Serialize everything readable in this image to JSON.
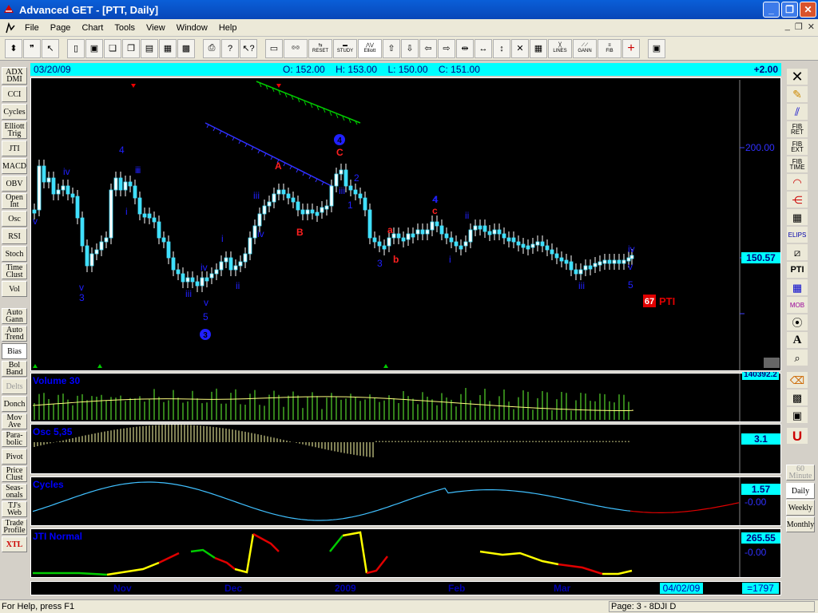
{
  "window": {
    "title": "Advanced GET - [PTT, Daily]"
  },
  "menu": [
    "File",
    "Page",
    "Chart",
    "Tools",
    "View",
    "Window",
    "Help"
  ],
  "toolbar": {
    "reset": "RESET",
    "study": "STUDY",
    "elliott": "Elliott",
    "lines": "LINES",
    "gann": "GANN",
    "fib": "FIB"
  },
  "left_tools": [
    "ADX DMI",
    "CCI",
    "Cycles",
    "Elliott Trig",
    "JTI",
    "MACD",
    "OBV",
    "Open Int",
    "Osc",
    "RSI",
    "Stoch",
    "Time Clust",
    "Vol",
    "Auto Gann",
    "Auto Trend",
    "Bias",
    "Bol Band",
    "Delts",
    "Donch",
    "Mov Ave",
    "Para-bolic",
    "Pivot",
    "Price Clust",
    "Seas-onals",
    "TJ's Web",
    "Trade Profile",
    "XTL"
  ],
  "right_tools": {
    "fib_ret": "FIB RET",
    "fib_ext": "FIB EXT",
    "fib_time": "FIB TIME",
    "elips": "ELIPS",
    "pti": "PTI",
    "mob": "MOB",
    "text_tool": "A"
  },
  "timeframes": [
    "60 Minute",
    "Daily",
    "Weekly",
    "Monthly"
  ],
  "info": {
    "date": "03/20/09",
    "open": "O: 152.00",
    "high": "H: 153.00",
    "low": "L: 150.00",
    "close": "C: 151.00",
    "change": "+2.00"
  },
  "price_axis": {
    "tick": "200.00",
    "current": "150.57"
  },
  "pti": {
    "value": "67",
    "label": "PTI"
  },
  "volume": {
    "title": "Volume 30",
    "value": "140392.2"
  },
  "osc": {
    "title": "Osc 5,35",
    "value": "3.1"
  },
  "cycles": {
    "title": "Cycles",
    "value": "1.57",
    "zero": "-0.00"
  },
  "jti": {
    "title": "JTI Normal",
    "value": "265.55",
    "zero": "-0.00"
  },
  "date_axis": {
    "labels": [
      "Nov",
      "Dec",
      "2009",
      "Feb",
      "Mar"
    ],
    "cursor_date": "04/02/09",
    "bar_index": "=1797"
  },
  "elliott": {
    "blue_labels": [
      "iv",
      "4",
      "ii",
      "i",
      "ii",
      "v",
      "3",
      "iii",
      "iv",
      "v",
      "5",
      "i",
      "ii",
      "iii",
      "iv",
      "iii",
      "4",
      "2",
      "1",
      "3",
      "4",
      "ii",
      "i",
      "iii",
      "iv",
      "v",
      "5",
      "v"
    ],
    "red_labels": [
      "A",
      "B",
      "C",
      "a",
      "b",
      "c"
    ],
    "circled": [
      "4",
      "3"
    ]
  },
  "chart_data": {
    "type": "candlestick",
    "symbol": "PTT",
    "period": "Daily",
    "x_range": [
      "Oct 2008",
      "Mar 2009"
    ],
    "y_tick": 200.0,
    "last": {
      "open": 152.0,
      "high": 153.0,
      "low": 150.0,
      "close": 151.0,
      "change": 2.0
    },
    "indicators": [
      "Volume 30",
      "Osc 5,35",
      "Cycles",
      "JTI Normal"
    ]
  },
  "status": {
    "help": "For Help, press F1",
    "page": "Page: 3 - 8DJI D"
  }
}
